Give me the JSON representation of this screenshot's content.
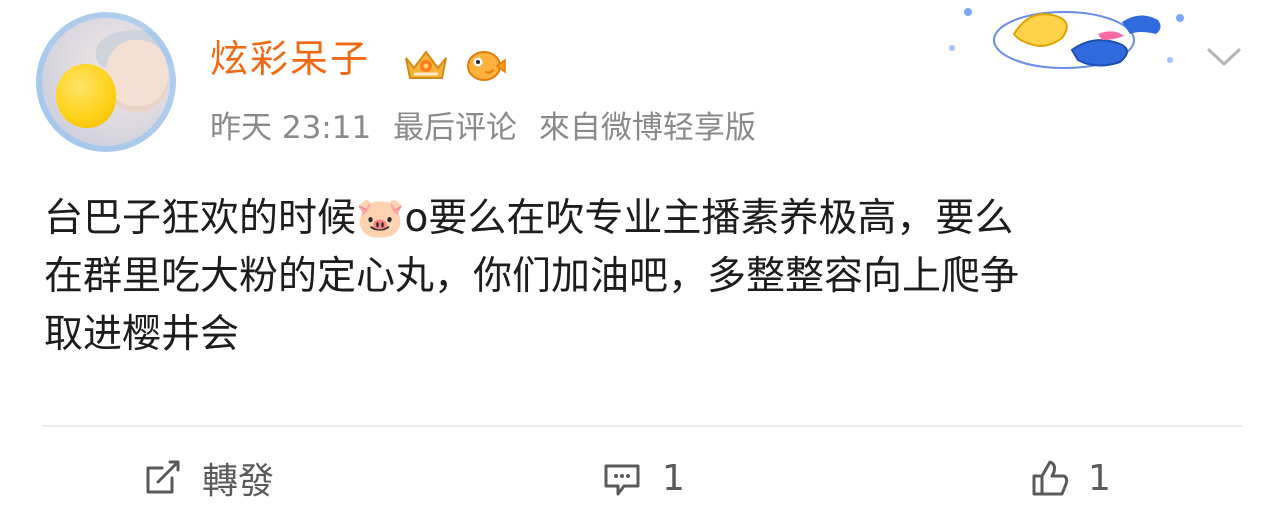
{
  "post": {
    "author": "炫彩呆子",
    "meta": {
      "time": "昨天 23:11",
      "status": "最后评论",
      "source": "來自微博轻享版"
    },
    "text_lines": [
      "台巴子狂欢的时候🐷o要么在吹专业主播素养极高，要么",
      "在群里吃大粉的定心丸，你们加油吧，多整整容向上爬争",
      "取进樱井会"
    ]
  },
  "actions": {
    "repost_label": "轉發",
    "comment_count": "1",
    "like_count": "1"
  },
  "icons": {
    "badge_1": "crown-vip-icon",
    "badge_2": "fish-icon",
    "menu": "chevron-down-icon",
    "repost": "edit-share-icon",
    "comment": "comment-icon",
    "like": "thumbs-up-icon"
  },
  "colors": {
    "author": "#f06a14",
    "meta": "#8a8a8a",
    "text": "#1d1d1d",
    "action": "#5a5a5a",
    "divider": "#ececec"
  }
}
